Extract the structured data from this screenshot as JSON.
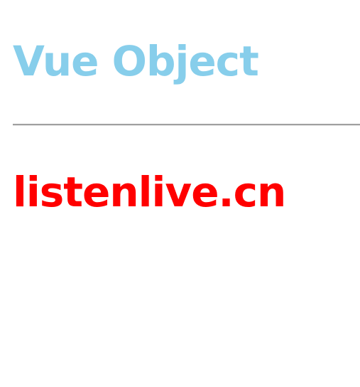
{
  "title": "Vue Object",
  "message": "listenlive.cn",
  "colors": {
    "title": "#87ceeb",
    "message": "#ff0000",
    "divider": "#a0a0a0"
  }
}
